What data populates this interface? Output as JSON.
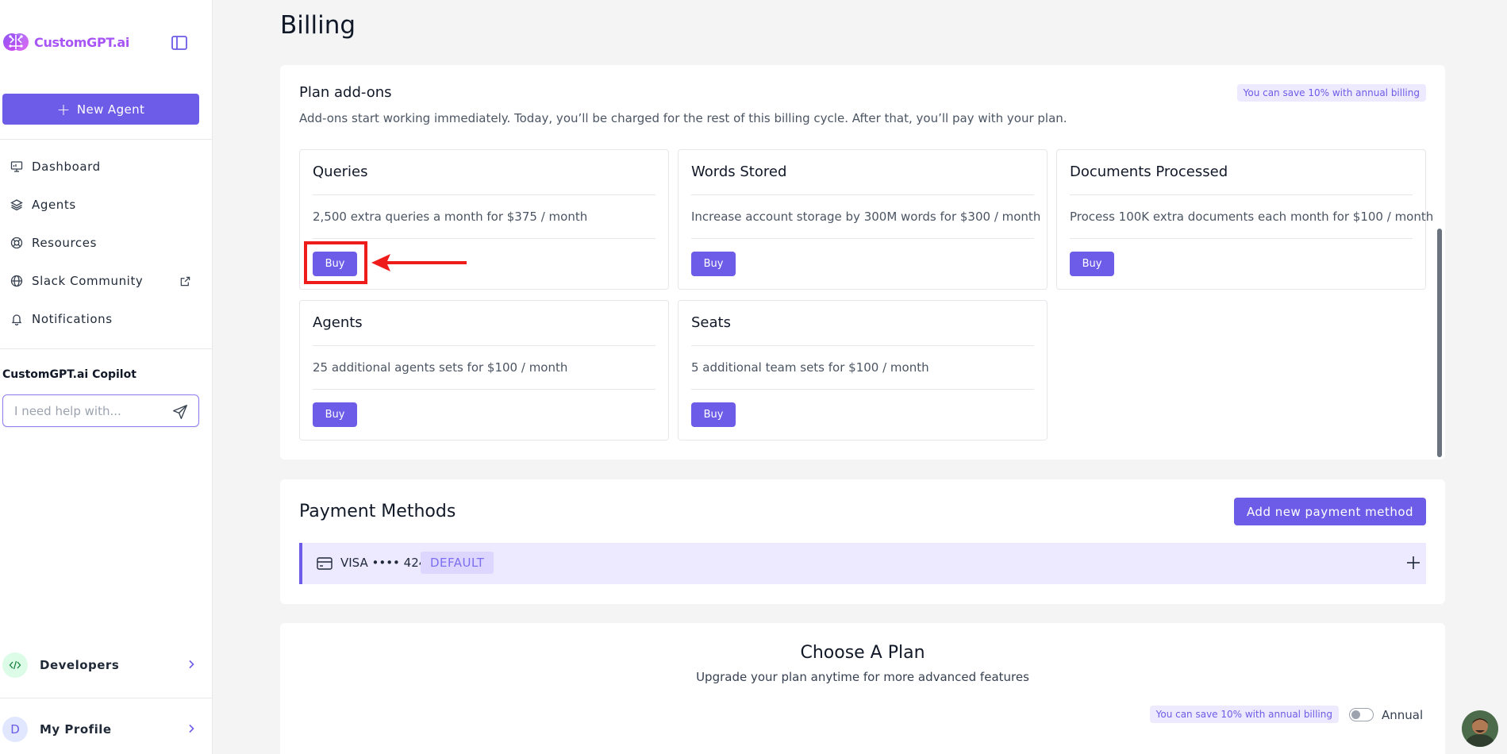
{
  "sidebar": {
    "brand": "CustomGPT.ai",
    "new_agent_label": "New Agent",
    "nav": [
      {
        "label": "Dashboard",
        "icon": "dashboard-icon"
      },
      {
        "label": "Agents",
        "icon": "layers-icon"
      },
      {
        "label": "Resources",
        "icon": "lifebuoy-icon"
      },
      {
        "label": "Slack Community",
        "icon": "globe-icon"
      },
      {
        "label": "Notifications",
        "icon": "bell-icon"
      }
    ],
    "copilot": {
      "title": "CustomGPT.ai Copilot",
      "placeholder": "I need help with..."
    },
    "developers_label": "Developers",
    "profile": {
      "label": "My Profile",
      "initial": "D"
    }
  },
  "main": {
    "title": "Billing",
    "addons": {
      "title": "Plan add-ons",
      "description": "Add-ons start working immediately. Today, you’ll be charged for the rest of this billing cycle. After that, you’ll pay with your plan.",
      "badge": "You can save 10% with annual billing",
      "items": [
        {
          "title": "Queries",
          "description": "2,500 extra queries a month for $375 / month",
          "button": "Buy"
        },
        {
          "title": "Words Stored",
          "description": "Increase account storage by 300M words for $300 / month",
          "button": "Buy"
        },
        {
          "title": "Documents Processed",
          "description": "Process 100K extra documents each month for $100 / month",
          "button": "Buy"
        },
        {
          "title": "Agents",
          "description": "25 additional agents sets for $100 / month",
          "button": "Buy"
        },
        {
          "title": "Seats",
          "description": "5 additional team sets for $100 / month",
          "button": "Buy"
        }
      ]
    },
    "payment": {
      "title": "Payment Methods",
      "add_button": "Add new payment method",
      "card_text": "VISA •••• 4242",
      "default_badge": "DEFAULT"
    },
    "plan": {
      "title": "Choose A Plan",
      "subtitle": "Upgrade your plan anytime for more advanced features",
      "badge": "You can save 10% with annual billing",
      "toggle_label": "Annual",
      "annual_enabled": false
    }
  },
  "colors": {
    "accent": "#6d5ce7",
    "accent_light": "#ede9fe",
    "brand": "#a855f7",
    "highlight": "#ef1c1c"
  }
}
